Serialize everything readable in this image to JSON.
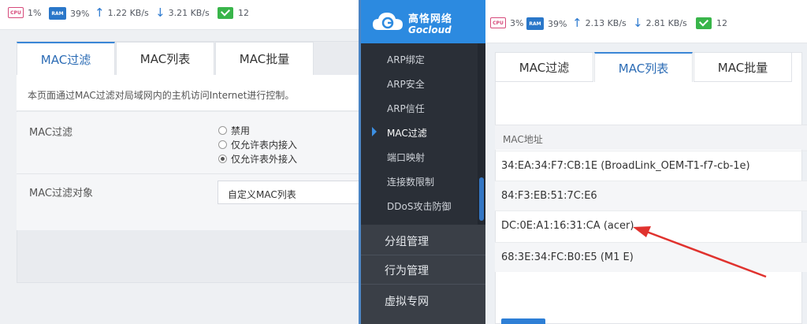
{
  "left": {
    "status": {
      "cpu_label": "CPU",
      "cpu": "1%",
      "ram_label": "RAM",
      "ram": "39%",
      "up": "1.22 KB/s",
      "down": "3.21 KB/s",
      "count": "12"
    },
    "tabs": [
      "MAC过滤",
      "MAC列表",
      "MAC批量"
    ],
    "description": "本页面通过MAC过滤对局域网内的主机访问Internet进行控制。",
    "filter_label": "MAC过滤",
    "filter_options": [
      "禁用",
      "仅允许表内接入",
      "仅允许表外接入"
    ],
    "filter_selected": 2,
    "target_label": "MAC过滤对象",
    "target_value": "自定义MAC列表"
  },
  "right": {
    "logo_cn": "高恪网络",
    "logo_en": "Gocloud",
    "status": {
      "cpu_label": "CPU",
      "cpu": "3%",
      "ram_label": "RAM",
      "ram": "39%",
      "up": "2.13 KB/s",
      "down": "2.81 KB/s",
      "count": "12"
    },
    "submenu": [
      "ARP绑定",
      "ARP安全",
      "ARP信任",
      "MAC过滤",
      "端口映射",
      "连接数限制",
      "DDoS攻击防御"
    ],
    "submenu_active": 3,
    "mainmenu": [
      "分组管理",
      "行为管理",
      "虚拟专网"
    ],
    "tabs": [
      "MAC过滤",
      "MAC列表",
      "MAC批量"
    ],
    "table_header": "MAC地址",
    "rows": [
      "34:EA:34:F7:CB:1E (BroadLink_OEM-T1-f7-cb-1e)",
      "84:F3:EB:51:7C:E6",
      "DC:0E:A1:16:31:CA (acer)",
      "68:3E:34:FC:B0:E5 (M1 E)"
    ]
  },
  "colors": {
    "accent": "#2c8ae0",
    "annotation_arrow": "#e0322e",
    "sidebar": "#2a2f37"
  }
}
